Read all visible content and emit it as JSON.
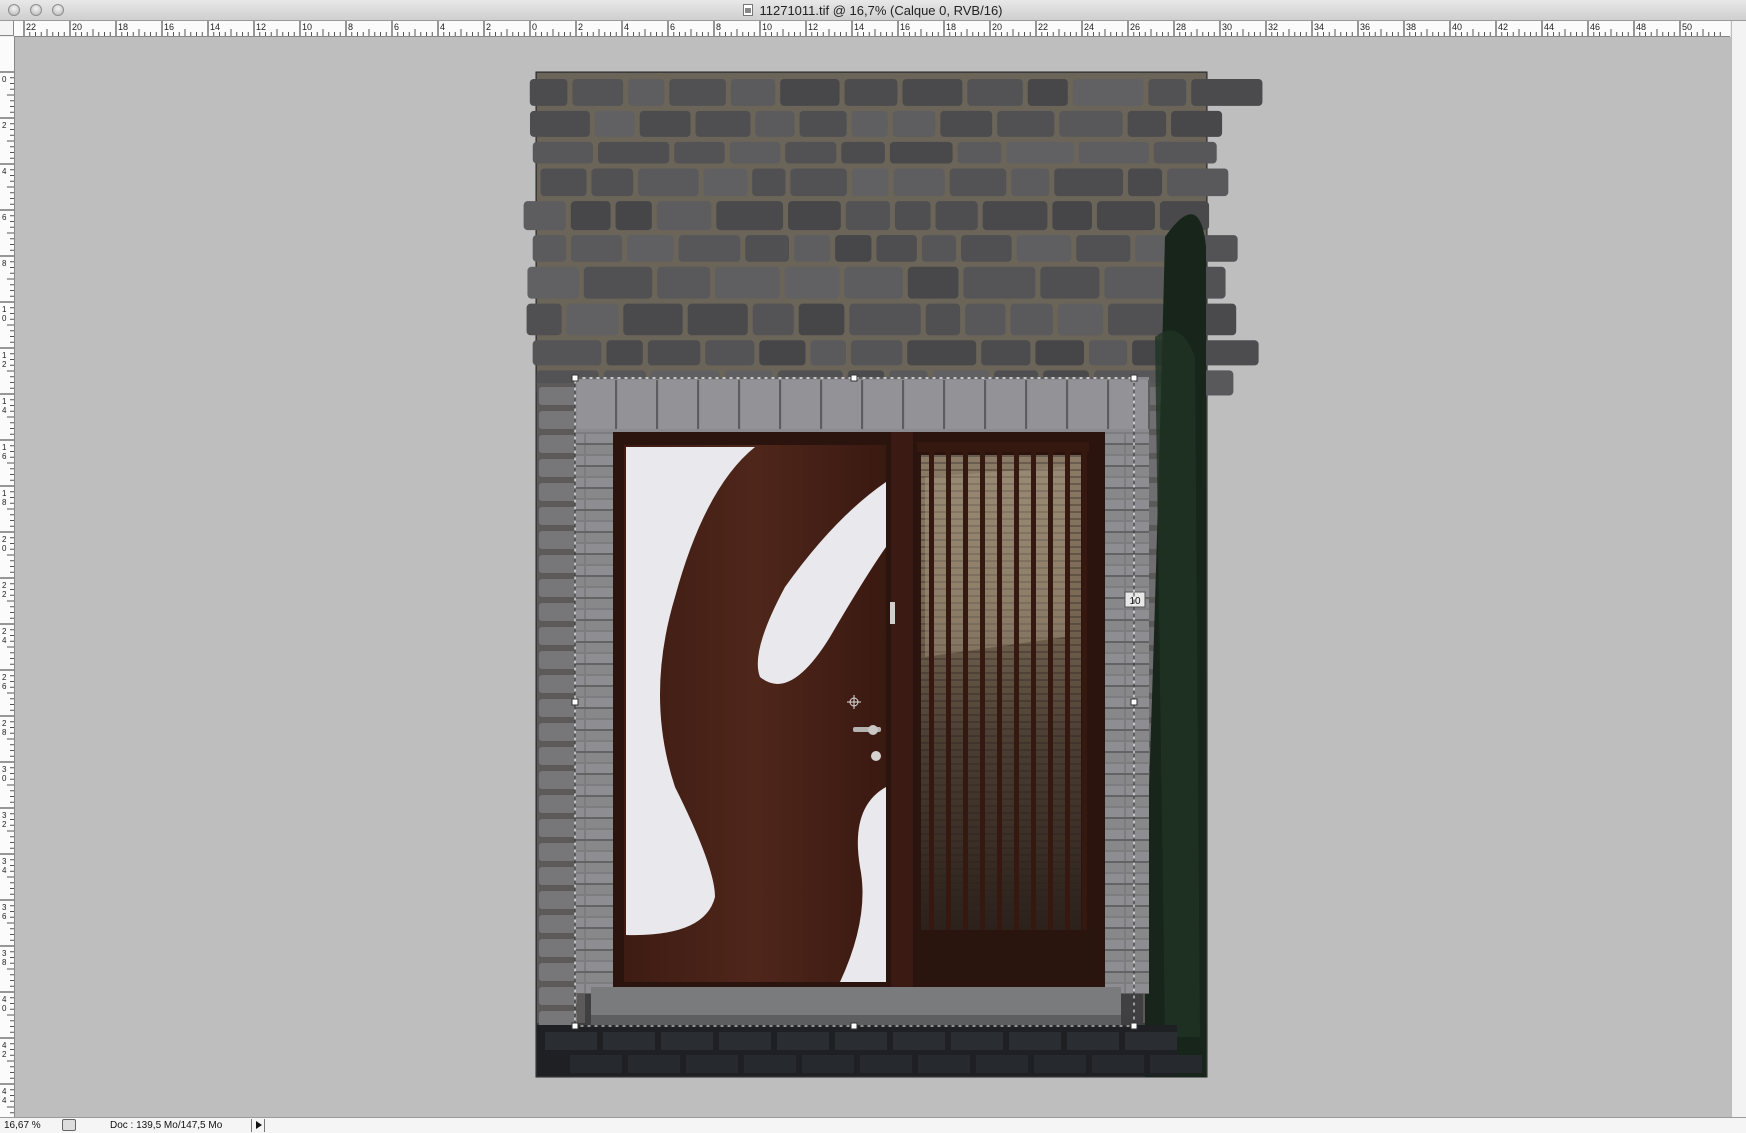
{
  "window": {
    "title": "11271011.tif @ 16,7% (Calque 0, RVB/16)"
  },
  "rulers": {
    "top_labels": [
      "22",
      "20",
      "18",
      "16",
      "14",
      "12",
      "10",
      "8",
      "6",
      "4",
      "2",
      "0",
      "2",
      "4",
      "6",
      "8",
      "10",
      "12",
      "14",
      "16",
      "18",
      "20",
      "22",
      "24",
      "26",
      "28",
      "30",
      "32",
      "34",
      "36",
      "38",
      "40",
      "42",
      "44",
      "46",
      "48",
      "50"
    ],
    "left_labels": [
      "0",
      "2",
      "4",
      "6",
      "8",
      "10",
      "12",
      "14",
      "16",
      "18",
      "20",
      "22",
      "24",
      "26",
      "28",
      "30",
      "32",
      "34",
      "36",
      "38",
      "40",
      "42",
      "44"
    ]
  },
  "status": {
    "zoom": "16,67 %",
    "doc_info": "Doc : 139,5 Mo/147,5 Mo"
  },
  "image": {
    "house_number": "10"
  },
  "colors": {
    "canvas_bg": "#bebebe",
    "door_wood": "#4a2318",
    "door_white": "#e9e8ec",
    "stone_dark": "#4b4b4d",
    "mortar": "#6b6458",
    "foliage": "#17251b"
  }
}
